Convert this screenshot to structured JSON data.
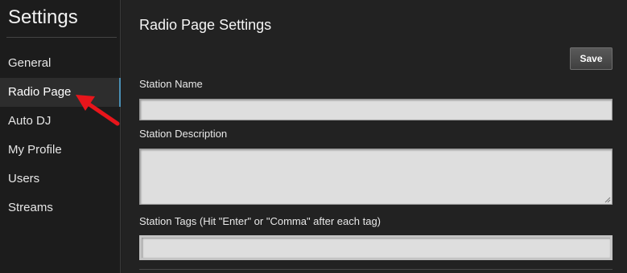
{
  "sidebar": {
    "title": "Settings",
    "items": [
      {
        "label": "General",
        "active": false
      },
      {
        "label": "Radio Page",
        "active": true
      },
      {
        "label": "Auto DJ",
        "active": false
      },
      {
        "label": "My Profile",
        "active": false
      },
      {
        "label": "Users",
        "active": false
      },
      {
        "label": "Streams",
        "active": false
      }
    ]
  },
  "main": {
    "title": "Radio Page Settings",
    "save_label": "Save",
    "fields": {
      "station_name": {
        "label": "Station Name",
        "value": "",
        "placeholder": ""
      },
      "station_description": {
        "label": "Station Description",
        "value": "",
        "placeholder": ""
      },
      "station_tags": {
        "label": "Station Tags (Hit \"Enter\" or \"Comma\" after each tag)",
        "value": "",
        "placeholder": ""
      }
    }
  },
  "colors": {
    "background": "#222222",
    "sidebar_bg": "#1c1c1c",
    "active_item_bg": "#2d2d2d",
    "active_indicator": "#4a8fb4",
    "input_bg": "#dedede",
    "annotation_arrow": "#e8151b"
  },
  "icons": {
    "annotation": "red-pointer-arrow-icon",
    "textarea_resize": "resize-grip-icon"
  }
}
